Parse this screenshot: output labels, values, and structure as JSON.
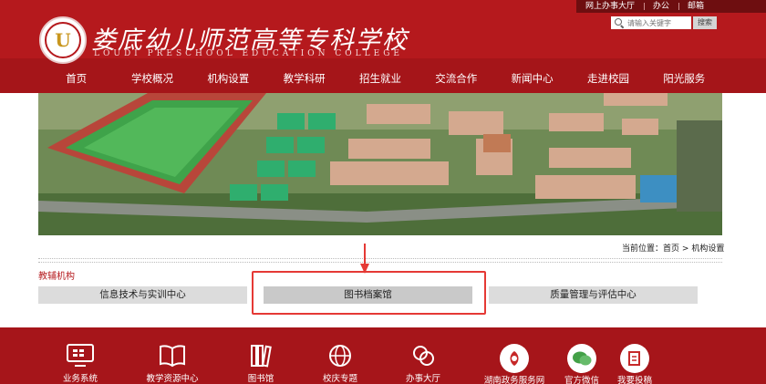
{
  "header": {
    "school_name_cn": "娄底幼儿师范高等专科学校",
    "school_name_en": "LOUDI PRESCHOOL EDUCATION COLLEGE",
    "top_links": [
      "网上办事大厅",
      "办公",
      "邮箱"
    ],
    "search": {
      "placeholder": "请输入关键字",
      "button_label": "搜索"
    },
    "nav": [
      "首页",
      "学校概况",
      "机构设置",
      "教学科研",
      "招生就业",
      "交流合作",
      "新闻中心",
      "走进校园",
      "阳光服务"
    ]
  },
  "breadcrumb": {
    "prefix": "当前位置：",
    "home": "首页",
    "sep": ">",
    "current": "机构设置"
  },
  "section": {
    "title": "教辅机构",
    "tabs": [
      "信息技术与实训中心",
      "图书档案馆",
      "质量管理与评估中心"
    ]
  },
  "footer": {
    "items": [
      "业务系统",
      "教学资源中心",
      "图书馆",
      "校庆专题",
      "办事大厅",
      "湖南政务服务网",
      "官方微信",
      "我要投稿"
    ]
  },
  "colors": {
    "brand_red": "#b5191d",
    "footer_red": "#a6151a",
    "highlight": "#e53935"
  }
}
